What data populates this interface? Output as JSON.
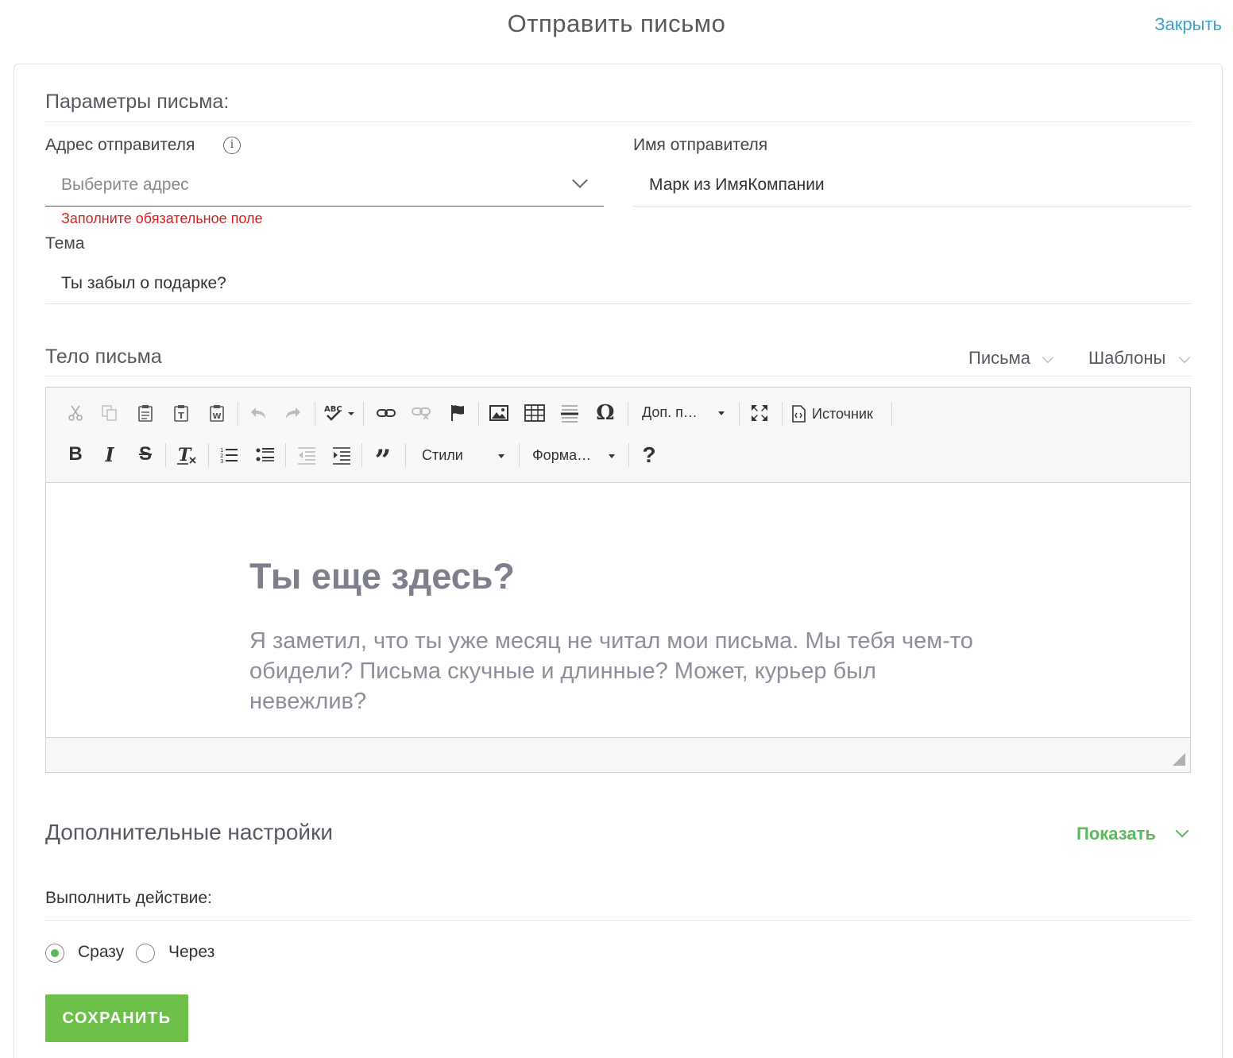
{
  "header": {
    "title": "Отправить письмо",
    "close_label": "Закрыть"
  },
  "params": {
    "title": "Параметры письма:",
    "sender_address_label": "Адрес отправителя",
    "sender_address_placeholder": "Выберите адрес",
    "sender_address_error": "Заполните обязательное поле",
    "sender_name_label": "Имя отправителя",
    "sender_name_value": "Марк из ИмяКомпании",
    "subject_label": "Тема",
    "subject_value": "Ты забыл о подарке?"
  },
  "body": {
    "title": "Тело письма",
    "tabs": [
      {
        "label": "Письма"
      },
      {
        "label": "Шаблоны"
      }
    ]
  },
  "editor": {
    "toolbar_row1": [
      {
        "icon": "cut-icon"
      },
      {
        "icon": "copy-icon"
      },
      {
        "icon": "paste-icon"
      },
      {
        "icon": "paste-text-icon"
      },
      {
        "icon": "paste-word-icon"
      },
      {
        "icon": "undo-icon"
      },
      {
        "icon": "redo-icon"
      },
      {
        "icon": "spellcheck-icon"
      },
      {
        "icon": "link-icon"
      },
      {
        "icon": "unlink-icon"
      },
      {
        "icon": "anchor-icon"
      },
      {
        "icon": "image-icon"
      },
      {
        "icon": "table-icon"
      },
      {
        "icon": "horizontal-line-icon"
      },
      {
        "icon": "special-char-icon"
      },
      {
        "icon": "maximize-icon"
      },
      {
        "icon": "source-icon"
      }
    ],
    "extra_combo_label": "Доп. п…",
    "source_label": "Источник",
    "styles_label": "Стили",
    "format_label": "Форма…",
    "content": {
      "heading": "Ты еще здесь?",
      "paragraph": "Я заметил, что ты уже месяц не читал мои письма. Мы тебя чем-то обидели? Письма скучные и длинные? Может, курьер был невежлив?"
    }
  },
  "advanced": {
    "title": "Дополнительные настройки",
    "show_label": "Показать"
  },
  "action": {
    "label": "Выполнить действие:",
    "options": [
      {
        "label": "Сразу",
        "checked": true
      },
      {
        "label": "Через",
        "checked": false
      }
    ]
  },
  "save_label": "СОХРАНИТЬ",
  "colors": {
    "accent_green": "#6cc04a",
    "link_blue": "#3aa3c7",
    "error_red": "#d32121"
  }
}
